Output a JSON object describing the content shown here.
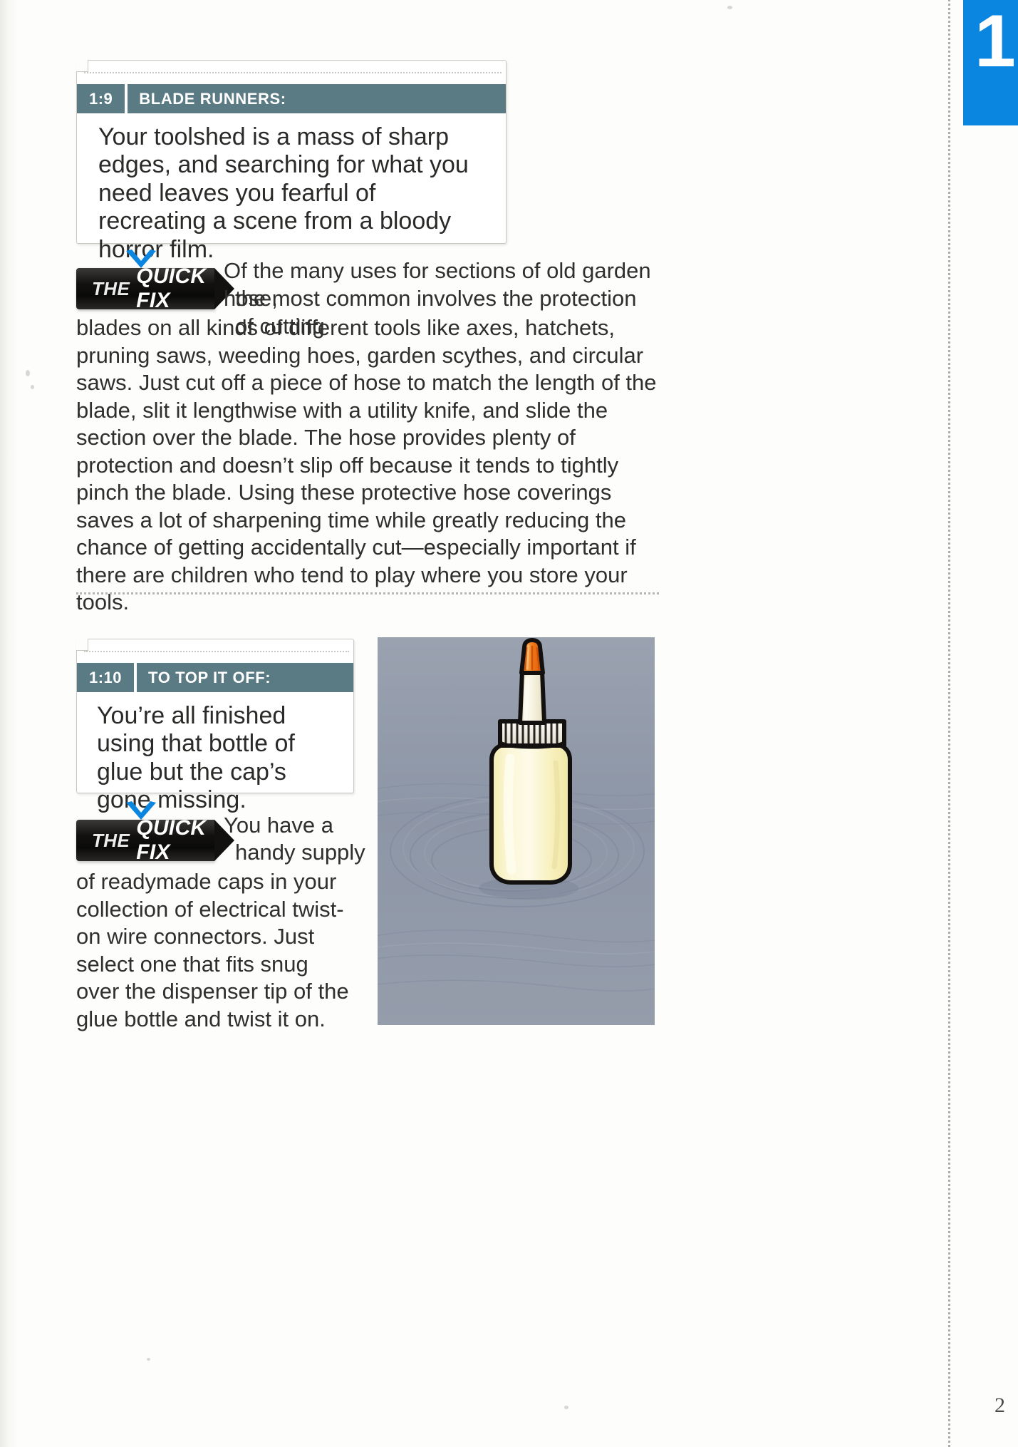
{
  "page": {
    "number": "2",
    "thumb_tab_number": "1",
    "accent_blue": "#0b86e0",
    "header_teal": "#5b7b84",
    "badge_black": "#121110",
    "illustration_bg": "#8d96a6"
  },
  "tips": [
    {
      "number": "1:9",
      "title": "BLADE RUNNERS:",
      "problem": "Your toolshed is a mass of sharp edges, and searching for what you need leaves you fearful of recreating a scene from a bloody horror film.",
      "badge": {
        "prefix": "THE",
        "label": "QUICK FIX"
      },
      "solution_lead": "Of the many uses for sections of old garden hose,",
      "solution_lead2": "the most common involves the protection of cutting",
      "solution_rest": "blades on all kinds of different tools like axes, hatchets, pruning saws, weeding hoes, garden scythes, and circular saws. Just cut off a piece of hose to match the length of the blade, slit it lengthwise with a utility knife, and slide the section over the blade. The hose provides plenty of protection and doesn’t slip off because it tends to tightly pinch the blade. Using these protective hose coverings saves a lot of sharpening time while greatly reducing the chance of getting accidentally cut—especially important if there are children who tend to play where you store your tools."
    },
    {
      "number": "1:10",
      "title": "TO TOP IT OFF:",
      "problem": "You’re all finished using that bottle of glue but the cap’s gone missing.",
      "badge": {
        "prefix": "THE",
        "label": "QUICK FIX"
      },
      "solution_lead": "You have a",
      "solution_lead2": "handy supply",
      "solution_rest": "of readymade caps in your collection of electrical twist-on wire connectors. Just select one that fits snug over the dispenser tip of the glue bottle and twist it on.",
      "illustration": {
        "name": "glue-bottle-on-workbench",
        "bottle_body_color": "#f7f2b8",
        "bottle_highlight_color": "#fdfbe4",
        "nozzle_color": "#f4efd8",
        "tip_color": "#f07a18",
        "collar_color": "#f2f0e8",
        "surface_color": "#8d96a6"
      }
    }
  ]
}
